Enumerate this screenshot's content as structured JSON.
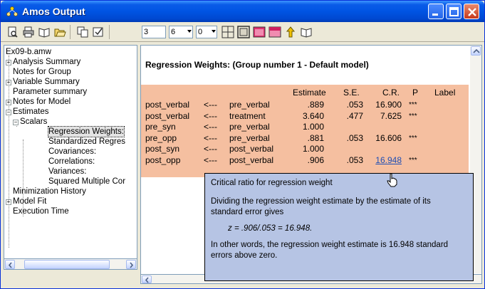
{
  "window": {
    "title": "Amos Output"
  },
  "toolbar": {
    "combo1": "3",
    "combo2": "6",
    "combo3": "0"
  },
  "tree": {
    "root": "Ex09-b.amw",
    "items": [
      "Analysis Summary",
      "Notes for Group",
      "Variable Summary",
      "Parameter summary",
      "Notes for Model",
      "Estimates",
      "Scalars",
      "Regression Weights:",
      "Standardized Regres",
      "Covariances:",
      "Correlations:",
      "Variances:",
      "Squared Multiple Cor",
      "Minimization History",
      "Model Fit",
      "Execution Time"
    ]
  },
  "main": {
    "title": "Regression Weights: (Group number 1 - Default model)",
    "columns": [
      "Estimate",
      "S.E.",
      "C.R.",
      "P",
      "Label"
    ],
    "rows": [
      {
        "lhs": "post_verbal",
        "arrow": "<---",
        "rhs": "pre_verbal",
        "estimate": ".889",
        "se": ".053",
        "cr": "16.900",
        "p": "***"
      },
      {
        "lhs": "post_verbal",
        "arrow": "<---",
        "rhs": "treatment",
        "estimate": "3.640",
        "se": ".477",
        "cr": "7.625",
        "p": "***"
      },
      {
        "lhs": "pre_syn",
        "arrow": "<---",
        "rhs": "pre_verbal",
        "estimate": "1.000",
        "se": "",
        "cr": "",
        "p": ""
      },
      {
        "lhs": "pre_opp",
        "arrow": "<---",
        "rhs": "pre_verbal",
        "estimate": ".881",
        "se": ".053",
        "cr": "16.606",
        "p": "***"
      },
      {
        "lhs": "post_syn",
        "arrow": "<---",
        "rhs": "post_verbal",
        "estimate": "1.000",
        "se": "",
        "cr": "",
        "p": ""
      },
      {
        "lhs": "post_opp",
        "arrow": "<---",
        "rhs": "post_verbal",
        "estimate": ".906",
        "se": ".053",
        "cr": "16.948",
        "p": "***"
      }
    ]
  },
  "tooltip": {
    "heading": "Critical ratio for regression weight",
    "line1": "Dividing the regression weight estimate by the estimate of its",
    "line2": "standard error gives",
    "formula": "z = .906/.053 = 16.948.",
    "line3": "In other words, the regression weight estimate is 16.948 standard",
    "line4": "errors above zero."
  }
}
